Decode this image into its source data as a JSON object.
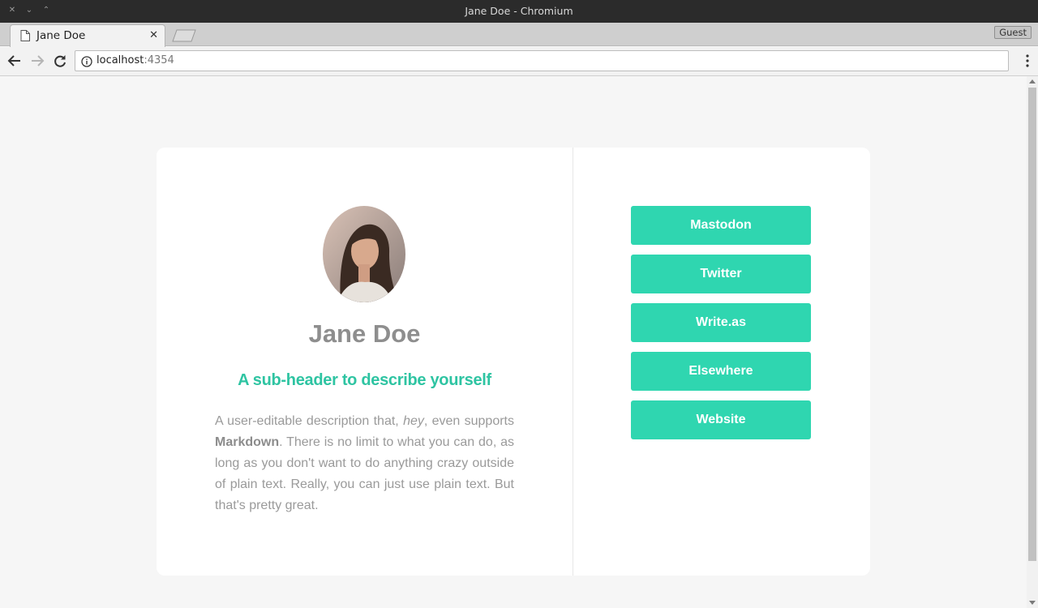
{
  "window": {
    "title": "Jane Doe - Chromium",
    "controls": [
      "close-icon",
      "minimize-icon",
      "maximize-icon"
    ]
  },
  "tabs": [
    {
      "title": "Jane Doe",
      "icon": "document-icon",
      "close_glyph": "✕"
    }
  ],
  "browser": {
    "guest_label": "Guest",
    "url_host": "localhost",
    "url_port": ":4354"
  },
  "profile": {
    "name": "Jane Doe",
    "subheader": "A sub-header to describe yourself",
    "description": {
      "p1": "A user-editable description that, ",
      "em": "hey",
      "p2": ", even supports ",
      "strong": "Markdown",
      "p3": ". There is no limit to what you can do, as long as you don't want to do anything crazy outside of plain text. Really, you can just use plain text. But that's pretty great."
    },
    "links": [
      {
        "label": "Mastodon"
      },
      {
        "label": "Twitter"
      },
      {
        "label": "Write.as"
      },
      {
        "label": "Elsewhere"
      },
      {
        "label": "Website"
      }
    ]
  },
  "colors": {
    "accent": "#2fd6b0",
    "subheader": "#2ec4a2",
    "text_muted": "#9a9a9a",
    "page_bg": "#f6f6f6",
    "card_bg": "#ffffff"
  }
}
